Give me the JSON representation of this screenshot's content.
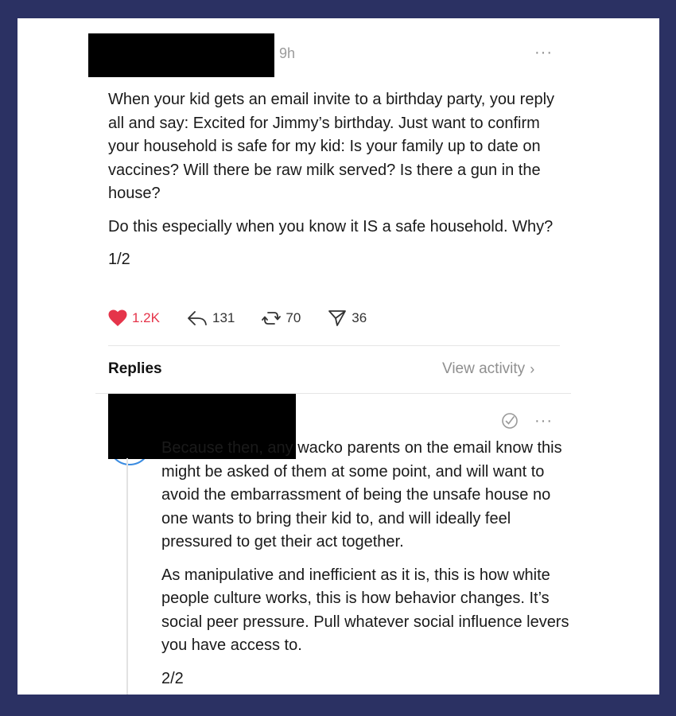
{
  "post": {
    "timestamp": "9h",
    "paragraphs": [
      "When your kid gets an email invite to a birthday party, you reply all and say: Excited for Jimmy’s birthday. Just want to confirm your household is safe for my kid: Is your family up to date on vaccines? Will there be raw milk served? Is there a gun in the house?",
      "Do this especially when you know it IS a safe household. Why?",
      "1/2"
    ],
    "actions": {
      "likes": "1.2K",
      "replies": "131",
      "reposts": "70",
      "shares": "36"
    },
    "like_color": "#e5344a"
  },
  "replies_section": {
    "label": "Replies",
    "view_activity": "View activity",
    "chevron": "›"
  },
  "reply": {
    "paragraphs": [
      "Because then, any wacko parents on the email know this might be asked of them at some point, and will want to avoid the embarrassment of being the unsafe house no one wants to bring their kid to, and will ideally feel pressured to get their act together.",
      "As manipulative and inefficient as it is, this is how white people culture works, this is how behavior changes. It’s social peer pressure. Pull whatever social influence levers you have access to.",
      "2/2"
    ]
  },
  "more_glyph": "···"
}
